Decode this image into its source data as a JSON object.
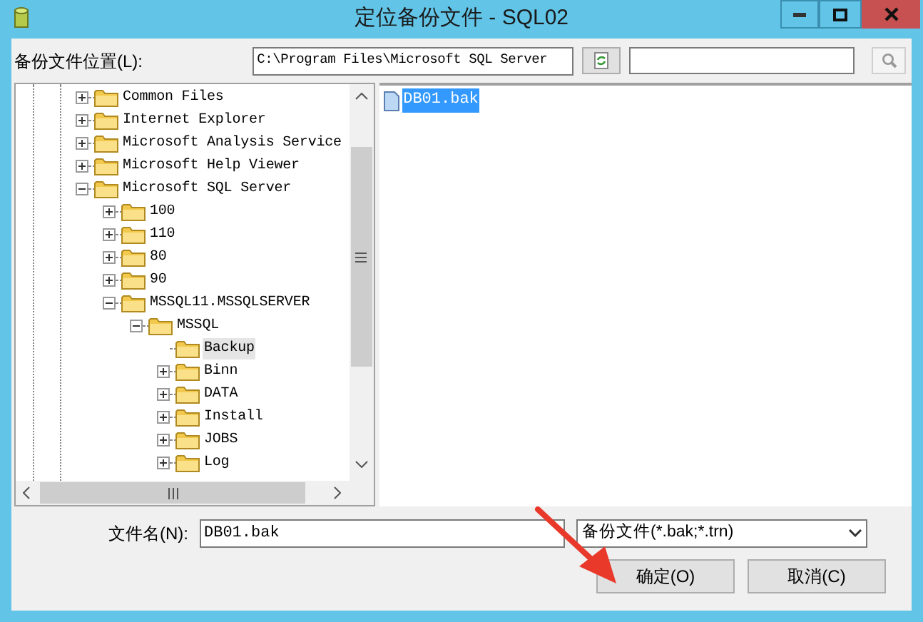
{
  "window": {
    "title": "定位备份文件 - SQL02"
  },
  "location": {
    "label": "备份文件位置(L):",
    "path": "C:\\Program Files\\Microsoft SQL Server"
  },
  "tree": [
    {
      "label": "Common Files",
      "expanded": false,
      "selected": false
    },
    {
      "label": "Internet Explorer",
      "expanded": false,
      "selected": false
    },
    {
      "label": "Microsoft Analysis Service",
      "expanded": false,
      "selected": false
    },
    {
      "label": "Microsoft Help Viewer",
      "expanded": false,
      "selected": false
    },
    {
      "label": "Microsoft SQL Server",
      "expanded": true,
      "selected": false,
      "children": [
        {
          "label": "100",
          "expanded": false,
          "selected": false
        },
        {
          "label": "110",
          "expanded": false,
          "selected": false
        },
        {
          "label": "80",
          "expanded": false,
          "selected": false
        },
        {
          "label": "90",
          "expanded": false,
          "selected": false
        },
        {
          "label": "MSSQL11.MSSQLSERVER",
          "expanded": true,
          "selected": false,
          "children": [
            {
              "label": "MSSQL",
              "expanded": true,
              "selected": false,
              "children": [
                {
                  "label": "Backup",
                  "selected": true
                },
                {
                  "label": "Binn",
                  "expanded": false,
                  "selected": false
                },
                {
                  "label": "DATA",
                  "expanded": false,
                  "selected": false
                },
                {
                  "label": "Install",
                  "expanded": false,
                  "selected": false
                },
                {
                  "label": "JOBS",
                  "expanded": false,
                  "selected": false
                },
                {
                  "label": "Log",
                  "expanded": false,
                  "selected": false
                }
              ]
            }
          ]
        }
      ]
    }
  ],
  "files": [
    {
      "name": "DB01.bak",
      "selected": true
    }
  ],
  "filename": {
    "label": "文件名(N):",
    "value": "DB01.bak"
  },
  "filetype": {
    "value": "备份文件(*.bak;*.trn)"
  },
  "buttons": [
    {
      "label": "确定(O)"
    },
    {
      "label": "取消(C)"
    }
  ]
}
